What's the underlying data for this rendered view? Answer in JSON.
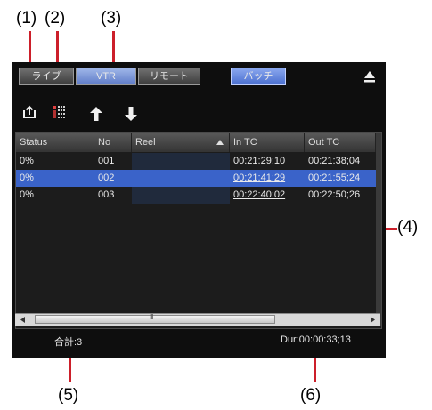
{
  "callouts": {
    "c1": "(1)",
    "c2": "(2)",
    "c3": "(3)",
    "c4": "(4)",
    "c5": "(5)",
    "c6": "(6)"
  },
  "tabs": {
    "live": "ライブ",
    "vtr": "VTR",
    "remote": "リモート",
    "batch": "バッチ"
  },
  "icons": {
    "export": "export-icon",
    "cliplist": "clip-list-icon",
    "up": "arrow-up-icon",
    "down": "arrow-down-icon",
    "eject": "eject-icon"
  },
  "table": {
    "headers": [
      "Status",
      "No",
      "Reel",
      "In TC",
      "Out TC"
    ],
    "rows": [
      {
        "status": "0%",
        "no": "001",
        "reel": "",
        "in": "00:21:29;10",
        "out": "00:21:38;04",
        "selected": false
      },
      {
        "status": "0%",
        "no": "002",
        "reel": "",
        "in": "00:21:41;29",
        "out": "00:21:55;24",
        "selected": true
      },
      {
        "status": "0%",
        "no": "003",
        "reel": "",
        "in": "00:22:40;02",
        "out": "00:22:50;26",
        "selected": false
      }
    ],
    "scroll_thumb_glyph": "III"
  },
  "footer": {
    "total": "合計:3",
    "duration": "Dur:00:00:33;13"
  },
  "colors": {
    "panel": "#0e0e0e",
    "selection": "#3a63c9",
    "callout_line": "#cc1f2a"
  }
}
